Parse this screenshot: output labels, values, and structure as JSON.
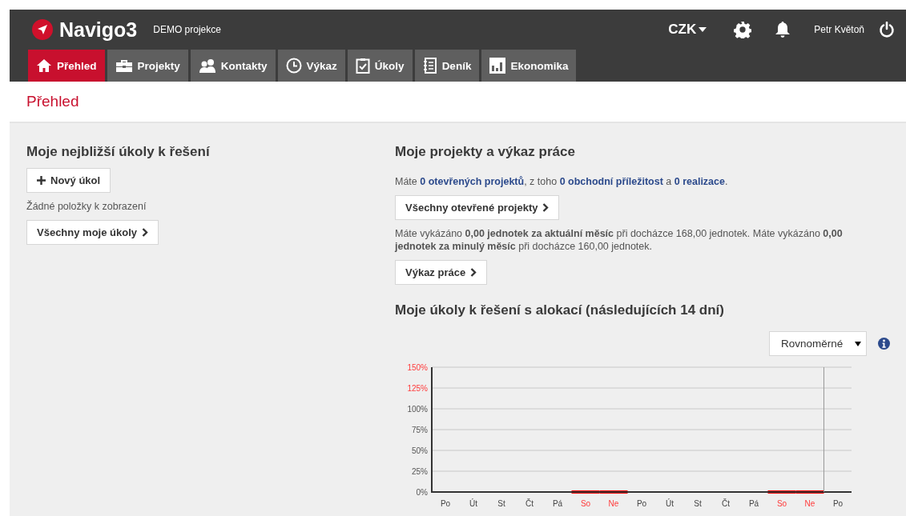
{
  "header": {
    "logo": "Navigo3",
    "project": "DEMO projekce",
    "currency": "CZK",
    "user": "Petr Květoň"
  },
  "tabs": [
    {
      "label": "Přehled",
      "selected": true
    },
    {
      "label": "Projekty",
      "selected": false
    },
    {
      "label": "Kontakty",
      "selected": false
    },
    {
      "label": "Výkaz",
      "selected": false
    },
    {
      "label": "Úkoly",
      "selected": false
    },
    {
      "label": "Deník",
      "selected": false
    },
    {
      "label": "Ekonomika",
      "selected": false
    }
  ],
  "page_title": "Přehled",
  "tasks_panel": {
    "title": "Moje nejbližší úkoly k řešení",
    "new_button": "Nový úkol",
    "empty_text": "Žádné položky k zobrazení",
    "all_button": "Všechny moje úkoly"
  },
  "projects_panel": {
    "title": "Moje projekty a výkaz práce",
    "summary": [
      {
        "text": "Máte ",
        "link": false
      },
      {
        "text": "0 otevřených projektů",
        "link": true
      },
      {
        "text": ", z toho ",
        "link": false
      },
      {
        "text": "0 obchodní příležitost",
        "link": true
      },
      {
        "text": " a ",
        "link": false
      },
      {
        "text": "0 realizace",
        "link": true
      },
      {
        "text": ".",
        "link": false
      }
    ],
    "projects_button": "Všechny otevřené projekty",
    "report_text": "Máte vykázáno **0,00 jednotek za aktuální měsíc** při docházce 168,00 jednotek. Máte vykázáno **0,00 jednotek za minulý měsíc** při docházce 160,00 jednotek.",
    "report_button": "Výkaz práce"
  },
  "allocation": {
    "title": "Moje úkoly k řešení s alokací (následujících 14 dní)",
    "mode": "Rovnoměrné",
    "days": [
      {
        "weekend": false
      },
      {
        "weekend": false
      },
      {
        "weekend": false
      },
      {
        "weekend": false
      },
      {
        "weekend": false
      },
      {
        "weekend": true
      },
      {
        "weekend": true
      },
      {
        "weekend": false
      },
      {
        "weekend": false
      },
      {
        "weekend": false
      },
      {
        "weekend": false
      },
      {
        "weekend": false
      },
      {
        "weekend": true
      },
      {
        "weekend": true
      },
      {
        "weekend": false
      }
    ],
    "chart_data": {
      "type": "bar",
      "categories": [
        "Po",
        "Út",
        "St",
        "Čt",
        "Pá",
        "So",
        "Ne",
        "Po",
        "Út",
        "St",
        "Čt",
        "Pá",
        "So",
        "Ne",
        "Po"
      ],
      "grid": true,
      "ylim": [
        0,
        150
      ],
      "yticks": [
        {
          "value": 0,
          "label": "0%"
        },
        {
          "value": 25,
          "label": "25%"
        },
        {
          "value": 50,
          "label": "50%"
        },
        {
          "value": 75,
          "label": "75%"
        },
        {
          "value": 100,
          "label": "100%"
        },
        {
          "value": 125,
          "label": "125%"
        },
        {
          "value": 150,
          "label": "150%"
        }
      ]
    }
  }
}
